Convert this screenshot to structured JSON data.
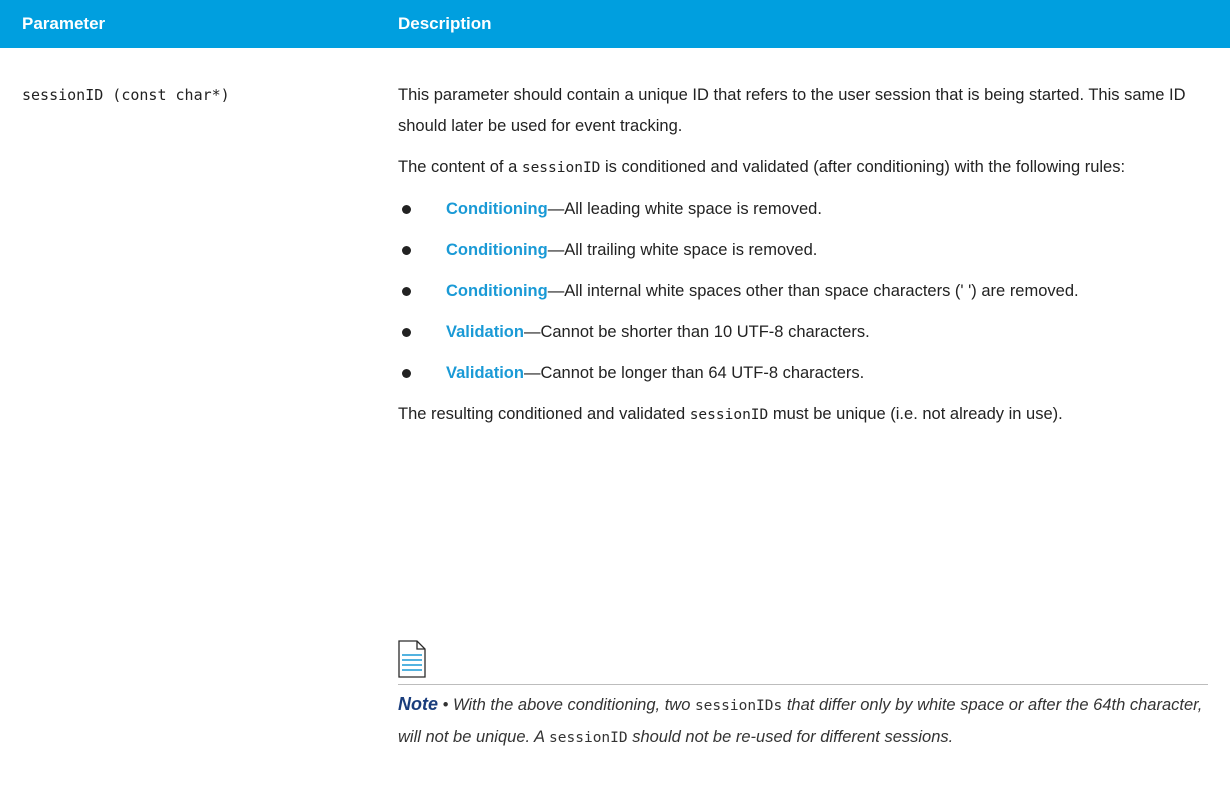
{
  "table": {
    "headers": {
      "parameter": "Parameter",
      "description": "Description"
    },
    "row": {
      "param_name": "sessionID (const char*)",
      "intro": "This parameter should contain a unique ID that refers to the user session that is being started. This same ID should later be used for event tracking.",
      "content_pre": "The content of a ",
      "content_code": "sessionID",
      "content_post": " is conditioned and validated (after conditioning) with the following rules:",
      "rules": [
        {
          "kind": "Conditioning",
          "text": "—All leading white space is removed."
        },
        {
          "kind": "Conditioning",
          "text": "—All trailing white space is removed."
        },
        {
          "kind": "Conditioning",
          "text": "—All internal white spaces other than space characters (' ') are removed."
        },
        {
          "kind": "Validation",
          "text": "—Cannot be shorter than 10 UTF-8 characters."
        },
        {
          "kind": "Validation",
          "text": "—Cannot be longer than 64 UTF-8 characters."
        }
      ],
      "result_pre": "The resulting conditioned and validated ",
      "result_code": "sessionID",
      "result_post": " must be unique (i.e. not already in use).",
      "note": {
        "icon": "note-document-icon",
        "label": "Note",
        "sep": " • ",
        "text1": "With the above conditioning, two ",
        "code1": "sessionIDs",
        "text2": " that differ only by white space or after the 64th character, will not be unique. A ",
        "code2": "sessionID",
        "text3": " should not be re-used for different sessions."
      }
    }
  },
  "colors": {
    "header_bg": "#009fdf",
    "rule_kind": "#1a9ad6",
    "note_label": "#1a3d7c"
  }
}
